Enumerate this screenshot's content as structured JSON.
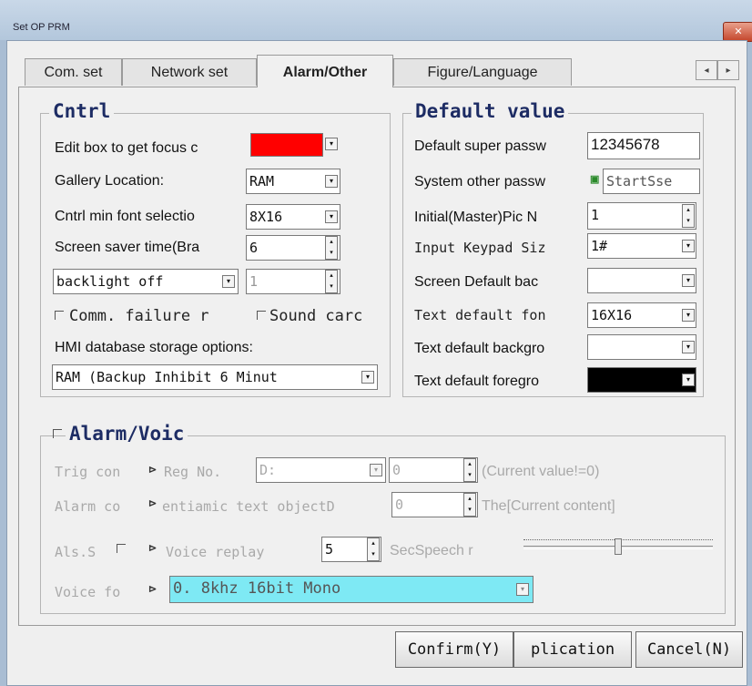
{
  "window": {
    "title": "Set OP PRM"
  },
  "tabs": [
    "Com. set",
    "Network set",
    "Alarm/Other",
    "Figure/Language"
  ],
  "tab_scroll": {
    "left": "◂",
    "right": "▸"
  },
  "cntrl": {
    "title": "Cntrl",
    "edit_focus_label": "Edit box to get focus c",
    "edit_focus_color": "#ff0000",
    "gallery_label": "Gallery Location:",
    "gallery_value": "RAM",
    "font_label": "Cntrl min font selectio",
    "font_value": "8X16",
    "saver_label": "Screen saver time(Bra",
    "saver_value": "6",
    "backlight_value": "backlight off",
    "backlight_num": "1",
    "comm_failure_label": "Comm. failure r",
    "sound_card_label": "Sound carc",
    "db_label": "HMI database storage options:",
    "db_value": "RAM (Backup Inhibit 6 Minut"
  },
  "default_value": {
    "title": "Default value",
    "super_pass_label": "Default super passw",
    "super_pass_value": "12345678",
    "other_pass_label": "System other passw",
    "other_pass_value": "StartSse",
    "master_pic_label": "Initial(Master)Pic N",
    "master_pic_value": "1",
    "keypad_label": "Input Keypad Siz",
    "keypad_value": "1#",
    "screen_bg_label": "Screen Default bac",
    "text_font_label": "Text default fon",
    "text_font_value": "16X16",
    "text_bg_label": "Text default backgro",
    "text_fg_label": "Text default foregro",
    "text_fg_color": "#000000"
  },
  "alarm": {
    "title": "Alarm/Voic",
    "trig_label": "Trig con",
    "reg_label": "Reg No.",
    "reg_value": "D:",
    "trig_num": "0",
    "current_value_label": "(Current value!=0)",
    "alarm_label": "Alarm co",
    "dyn_text_label": "entiamic text objectD",
    "dyn_num": "0",
    "current_content_label": "The[Current content]",
    "als_label": "Als.S",
    "voice_replay_label": "Voice replay",
    "voice_replay_value": "5",
    "sec_speech_label": "SecSpeech r",
    "voice_format_label": "Voice fo",
    "voice_format_value": "0. 8khz  16bit Mono",
    "voice_format_color": "#7ee9f4"
  },
  "buttons": {
    "confirm": "Confirm(Y)",
    "application": "plication",
    "cancel": "Cancel(N)"
  },
  "icons": {
    "dropdown": "▾",
    "spin_up": "▴",
    "spin_down": "▾",
    "chip": "⊳"
  }
}
